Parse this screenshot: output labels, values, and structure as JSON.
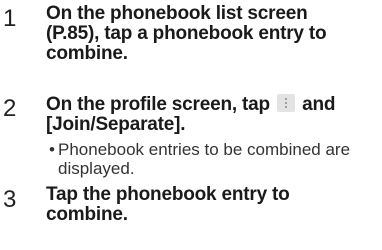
{
  "steps": [
    {
      "number": "1",
      "text": "On the phonebook list screen (P.85), tap a phonebook entry to combine."
    },
    {
      "number": "2",
      "text_before_icon": "On the profile screen, tap",
      "icon": "menu-icon",
      "text_after_icon": "and [Join/Separate].",
      "note_bullet": "•",
      "note": "Phonebook entries to be combined are displayed."
    },
    {
      "number": "3",
      "text": "Tap the phonebook entry to combine."
    }
  ]
}
